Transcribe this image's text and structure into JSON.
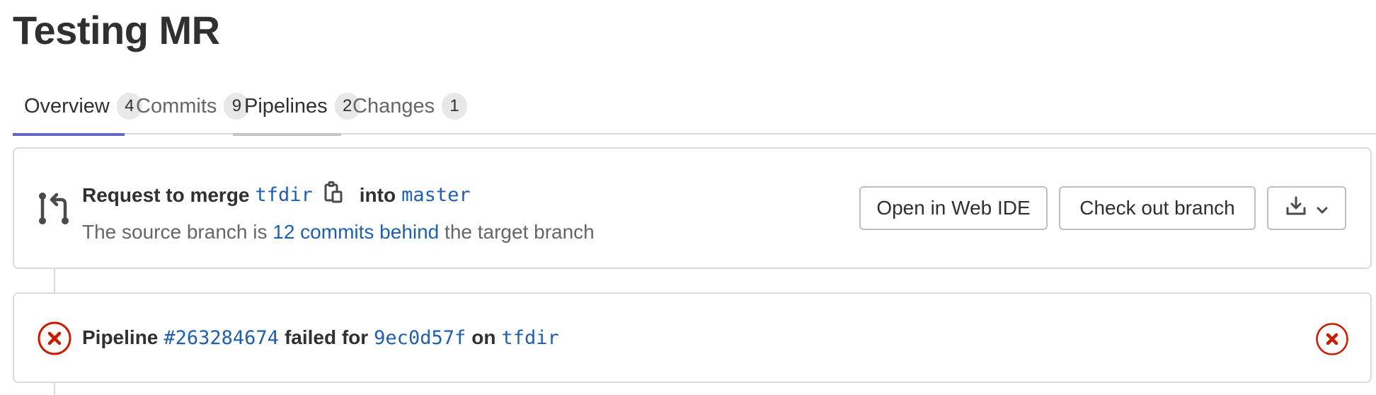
{
  "page": {
    "title": "Testing MR"
  },
  "tabs": [
    {
      "label": "Overview",
      "count": "4"
    },
    {
      "label": "Commits",
      "count": "9"
    },
    {
      "label": "Pipelines",
      "count": "2"
    },
    {
      "label": "Changes",
      "count": "1"
    }
  ],
  "merge_request": {
    "request_label": "Request to merge",
    "source_branch": "tfdir",
    "into_label": "into",
    "target_branch": "master",
    "status_prefix": "The source branch is",
    "behind_link": "12 commits behind",
    "status_suffix": "the target branch",
    "open_web_ide_label": "Open in Web IDE",
    "check_out_branch_label": "Check out branch"
  },
  "pipeline": {
    "label": "Pipeline",
    "id": "#263284674",
    "failed_for": "failed for",
    "commit_sha": "9ec0d57f",
    "on_label": "on",
    "branch": "tfdir",
    "status": "failed",
    "status_color": "#c91c00"
  },
  "colors": {
    "link": "#1f5fb0",
    "active_tab_underline": "#6666c4",
    "failed": "#c91c00"
  }
}
